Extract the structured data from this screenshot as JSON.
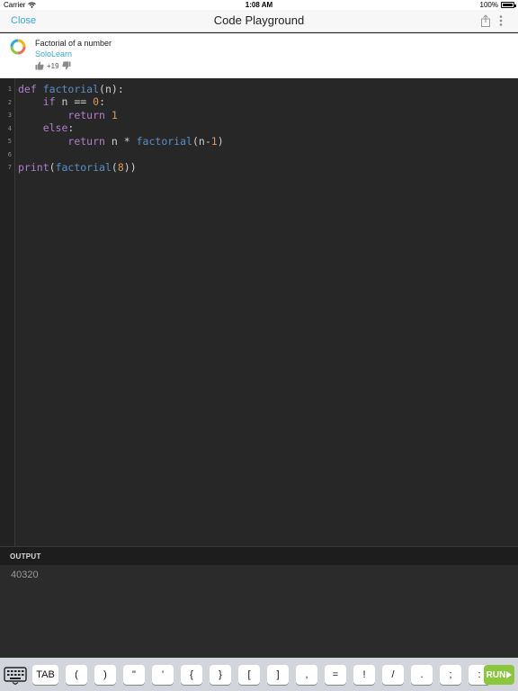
{
  "status_bar": {
    "carrier": "Carrier",
    "time": "1:08 AM",
    "battery": "100%"
  },
  "nav": {
    "close_label": "Close",
    "title": "Code Playground"
  },
  "code_info": {
    "title": "Factorial of a number",
    "author": "SoloLearn",
    "votes": "+19"
  },
  "editor": {
    "language": "python",
    "line_numbers": [
      "1",
      "2",
      "3",
      "4",
      "5",
      "6",
      "7"
    ],
    "lines": [
      "def factorial(n):",
      "    if n == 0:",
      "        return 1",
      "    else:",
      "        return n * factorial(n-1)",
      "",
      "print(factorial(8))"
    ]
  },
  "output": {
    "label": "OUTPUT",
    "text": "40320"
  },
  "toolbar": {
    "keys": [
      "TAB",
      "(",
      ")",
      "\"",
      "'",
      "{",
      "}",
      "[",
      "]",
      ",",
      "=",
      "!",
      "/",
      ".",
      ";",
      ":"
    ],
    "run_label": "RUN"
  },
  "colors": {
    "accent": "#34a9d6",
    "run": "#8cc63f",
    "keyword": "#b07ec8",
    "function": "#5a8fc6",
    "number": "#d7995a"
  }
}
